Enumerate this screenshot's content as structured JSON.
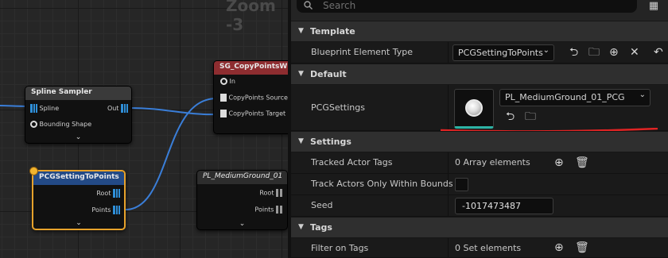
{
  "graph": {
    "zoom_label": "Zoom -3",
    "nodes": {
      "spline_sampler": {
        "title": "Spline Sampler",
        "in_pins": [
          "Spline",
          "Bounding Shape"
        ],
        "out_pin": "Out"
      },
      "copy_points": {
        "title": "SG_CopyPointsWithi",
        "pins": [
          "In",
          "CopyPoints Source",
          "CopyPoints Target"
        ]
      },
      "pcg_setting_to_points": {
        "title": "PCGSettingToPoints",
        "pins": [
          "Root",
          "Points"
        ]
      },
      "pl_medium_ground": {
        "title": "PL_MediumGround_01",
        "pins": [
          "Root",
          "Points"
        ]
      }
    },
    "wire_color": "#3a7ed8",
    "selection_color": "#e7a22b"
  },
  "details": {
    "search": {
      "placeholder": "Search"
    },
    "sections": {
      "template": "Template",
      "default": "Default",
      "settings": "Settings",
      "tags": "Tags"
    },
    "template": {
      "blueprint_element_type": {
        "label": "Blueprint Element Type",
        "value": "PCGSettingToPoints"
      }
    },
    "default": {
      "pcg_settings": {
        "label": "PCGSettings",
        "asset": "PL_MediumGround_01_PCG"
      }
    },
    "settings": {
      "tracked_actor_tags": {
        "label": "Tracked Actor Tags",
        "value": "0 Array elements"
      },
      "track_actors_only_within_bounds": {
        "label": "Track Actors Only Within Bounds",
        "checked": false
      },
      "seed": {
        "label": "Seed",
        "value": "-1017473487"
      }
    },
    "tags": {
      "filter_on_tags": {
        "label": "Filter on Tags",
        "value": "0 Set elements"
      }
    },
    "annotation_color": "#e02424",
    "accent": "#2eb2a4"
  }
}
